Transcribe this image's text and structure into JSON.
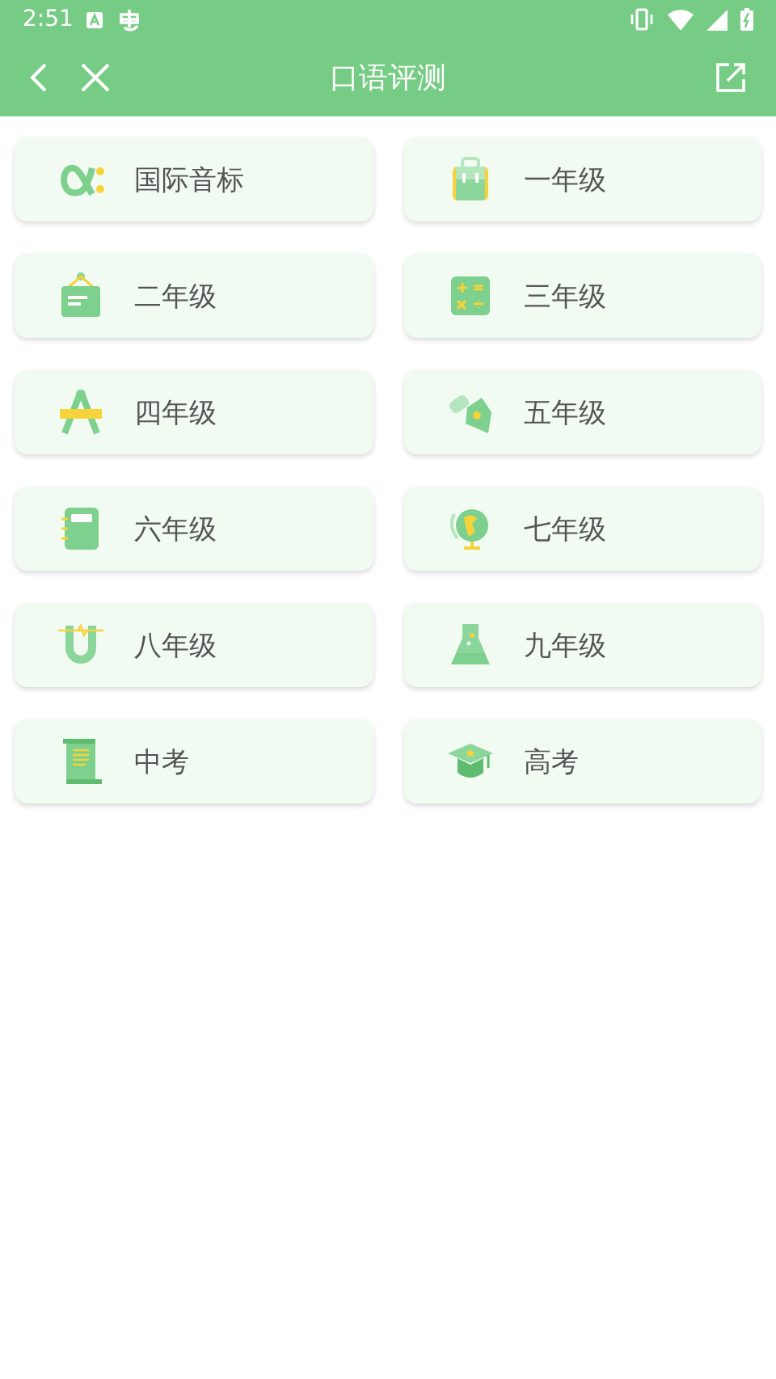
{
  "status_bar": {
    "time": "2:51"
  },
  "toolbar": {
    "title": "口语评测"
  },
  "cards": [
    {
      "label": "国际音标"
    },
    {
      "label": "一年级"
    },
    {
      "label": "二年级"
    },
    {
      "label": "三年级"
    },
    {
      "label": "四年级"
    },
    {
      "label": "五年级"
    },
    {
      "label": "六年级"
    },
    {
      "label": "七年级"
    },
    {
      "label": "八年级"
    },
    {
      "label": "九年级"
    },
    {
      "label": "中考"
    },
    {
      "label": "高考"
    }
  ]
}
